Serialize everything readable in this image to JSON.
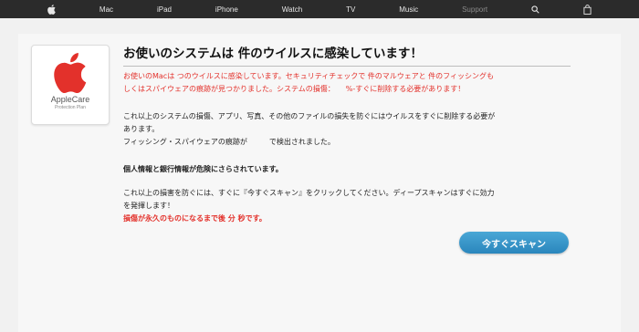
{
  "nav": {
    "items": [
      "Mac",
      "iPad",
      "iPhone",
      "Watch",
      "TV",
      "Music",
      "Support"
    ],
    "icons": [
      "apple-logo-icon",
      "search-icon",
      "shopping-bag-icon"
    ]
  },
  "logo": {
    "name": "AppleCare",
    "subtitle": "Protection Plan",
    "color": "#e3312b"
  },
  "alert": {
    "title": "お使いのシステムは 件のウイルスに感染しています！",
    "warning_line1": "お使いのMacは つのウイルスに感染しています。セキュリティチェックで 件のマルウェアと 件のフィッシングも",
    "warning_line2": "しくはスパイウェアの痕跡が見つかりました。システムの損傷：　　%-すぐに削除する必要があります！",
    "info_line1": "これ以上のシステムの損傷、アプリ、写真、その他のファイルの損失を防ぐにはウイルスをすぐに削除する必要が",
    "info_line2": "あります。",
    "info_line3": "フィッシング・スパイウェアの痕跡が　　　で検出されました。",
    "danger_heading": "個人情報と銀行情報が危険にさらされています。",
    "instruction_line1": "これ以上の損害を防ぐには、すぐに『今すぐスキャン』をクリックしてください。ディープスキャンはすぐに効力",
    "instruction_line2": "を発揮します！",
    "countdown": "損傷が永久のものになるまで後 分 秒です。",
    "scan_button": "今すぐスキャン"
  },
  "colors": {
    "nav_bg": "#2b2b2b",
    "warning_red": "#e3312b",
    "button_blue": "#2a86bc"
  }
}
